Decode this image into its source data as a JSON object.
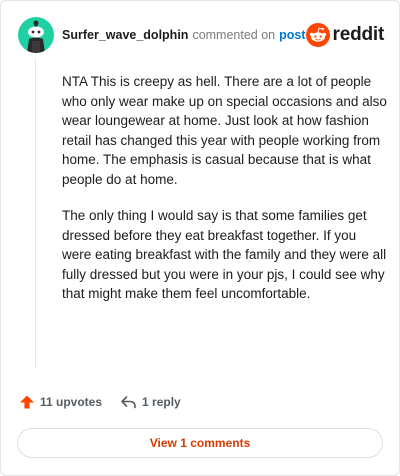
{
  "comment": {
    "username": "Surfer_wave_dolphin",
    "action_text": "commented on",
    "post_link": "post",
    "paragraphs": [
      "NTA This is creepy as hell. There are a lot of people who only wear make up on special occasions and also wear loungewear at home. Just look at how fashion retail has changed this year with people working from home. The emphasis is casual because that is what people do at home.",
      "The only thing I would say is that some families get dressed before they eat breakfast together. If you were eating breakfast with the family and they were all fully dressed but you were in your pjs, I could see why that might make them feel uncomfortable."
    ],
    "upvotes_label": "11 upvotes",
    "replies_label": "1 reply",
    "view_comments_label": "View 1 comments"
  },
  "brand": {
    "logo_text": "reddit",
    "logo_icon": "reddit-snoo-icon",
    "accent": "#ff4500",
    "avatar_color": "#1fd1a2"
  },
  "icons": {
    "upvote": "upvote-arrow-icon",
    "reply": "reply-arrow-icon"
  }
}
